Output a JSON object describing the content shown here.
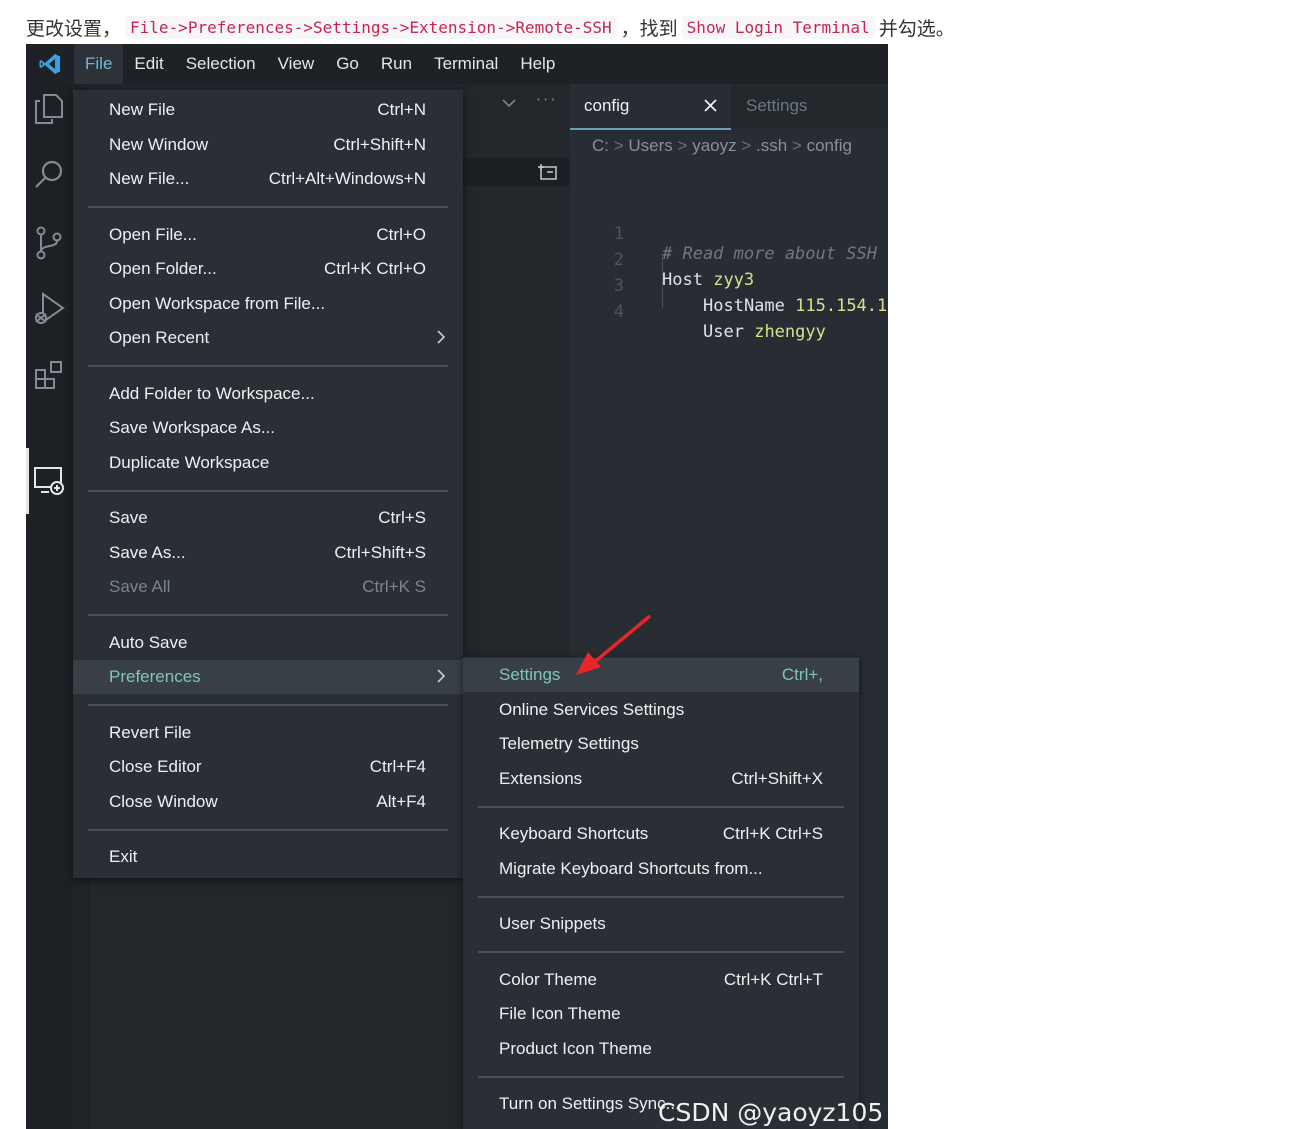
{
  "intro": {
    "prefix": "更改设置，",
    "path_code": "File->Preferences->Settings->Extension->Remote-SSH",
    "middle": "，找到",
    "option_code": "Show Login Terminal",
    "suffix": "并勾选。"
  },
  "menubar": [
    "File",
    "Edit",
    "Selection",
    "View",
    "Go",
    "Run",
    "Terminal",
    "Help"
  ],
  "activity_icons": [
    "explorer-icon",
    "search-icon",
    "source-control-icon",
    "run-debug-icon",
    "extensions-icon",
    "remote-explorer-icon"
  ],
  "editor": {
    "tabs": [
      {
        "label": "config",
        "active": true
      },
      {
        "label": "Settings",
        "active": false
      }
    ],
    "breadcrumb": [
      "C:",
      "Users",
      "yaoyz",
      ".ssh",
      "config"
    ],
    "lines": [
      {
        "num": "1",
        "text": "# Read more about SSH"
      },
      {
        "num": "2",
        "key": "Host",
        "value": "zyy3"
      },
      {
        "num": "3",
        "key": "HostName",
        "value": "115.154.1"
      },
      {
        "num": "4",
        "key": "User",
        "value": "zhengyy"
      }
    ]
  },
  "file_menu": {
    "groups": [
      [
        {
          "label": "New File",
          "shortcut": "Ctrl+N"
        },
        {
          "label": "New Window",
          "shortcut": "Ctrl+Shift+N"
        },
        {
          "label": "New File...",
          "shortcut": "Ctrl+Alt+Windows+N"
        }
      ],
      [
        {
          "label": "Open File...",
          "shortcut": "Ctrl+O"
        },
        {
          "label": "Open Folder...",
          "shortcut": "Ctrl+K Ctrl+O"
        },
        {
          "label": "Open Workspace from File...",
          "shortcut": ""
        },
        {
          "label": "Open Recent",
          "shortcut": "",
          "submenu": true
        }
      ],
      [
        {
          "label": "Add Folder to Workspace...",
          "shortcut": ""
        },
        {
          "label": "Save Workspace As...",
          "shortcut": ""
        },
        {
          "label": "Duplicate Workspace",
          "shortcut": ""
        }
      ],
      [
        {
          "label": "Save",
          "shortcut": "Ctrl+S"
        },
        {
          "label": "Save As...",
          "shortcut": "Ctrl+Shift+S"
        },
        {
          "label": "Save All",
          "shortcut": "Ctrl+K S",
          "disabled": true
        }
      ],
      [
        {
          "label": "Auto Save",
          "shortcut": ""
        },
        {
          "label": "Preferences",
          "shortcut": "",
          "submenu": true,
          "highlighted": true
        }
      ],
      [
        {
          "label": "Revert File",
          "shortcut": ""
        },
        {
          "label": "Close Editor",
          "shortcut": "Ctrl+F4"
        },
        {
          "label": "Close Window",
          "shortcut": "Alt+F4"
        }
      ],
      [
        {
          "label": "Exit",
          "shortcut": ""
        }
      ]
    ]
  },
  "preferences_menu": {
    "groups": [
      [
        {
          "label": "Settings",
          "shortcut": "Ctrl+,",
          "highlighted": true
        },
        {
          "label": "Online Services Settings",
          "shortcut": ""
        },
        {
          "label": "Telemetry Settings",
          "shortcut": ""
        },
        {
          "label": "Extensions",
          "shortcut": "Ctrl+Shift+X"
        }
      ],
      [
        {
          "label": "Keyboard Shortcuts",
          "shortcut": "Ctrl+K Ctrl+S"
        },
        {
          "label": "Migrate Keyboard Shortcuts from...",
          "shortcut": ""
        }
      ],
      [
        {
          "label": "User Snippets",
          "shortcut": ""
        }
      ],
      [
        {
          "label": "Color Theme",
          "shortcut": "Ctrl+K Ctrl+T"
        },
        {
          "label": "File Icon Theme",
          "shortcut": ""
        },
        {
          "label": "Product Icon Theme",
          "shortcut": ""
        }
      ],
      [
        {
          "label": "Turn on Settings Sync...",
          "shortcut": ""
        }
      ]
    ]
  },
  "watermark": "CSDN @yaoyz105",
  "colors": {
    "highlight_text": "#7ec7b7",
    "menubar_active": "#6fb7d6",
    "arrow": "#e8262a",
    "code_value": "#d7e08f",
    "comment": "#6f7781"
  }
}
